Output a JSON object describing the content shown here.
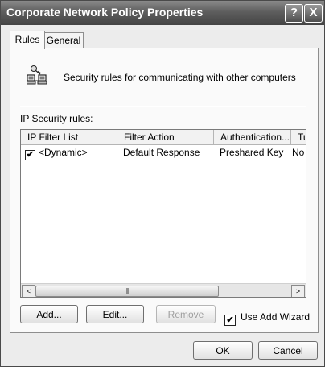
{
  "window": {
    "title": "Corporate Network Policy Properties",
    "help_button": "?",
    "close_button": "X"
  },
  "tabs": [
    {
      "label": "Rules",
      "active": true
    },
    {
      "label": "General",
      "active": false
    }
  ],
  "header": {
    "icon": "network-computers-icon",
    "text": "Security rules for communicating with other computers"
  },
  "list_label": "IP Security rules:",
  "table": {
    "columns": [
      "IP Filter List",
      "Filter Action",
      "Authentication...",
      "Tu"
    ],
    "rows": [
      {
        "checked": true,
        "ip_filter_list": "<Dynamic>",
        "filter_action": "Default Response",
        "authentication": "Preshared Key",
        "tunnel": "No"
      }
    ]
  },
  "scrollbar": {
    "left_arrow": "<",
    "right_arrow": ">",
    "thumb_grip": "|||"
  },
  "buttons": {
    "add": "Add...",
    "edit": "Edit...",
    "remove": "Remove",
    "ok": "OK",
    "cancel": "Cancel"
  },
  "use_add_wizard": {
    "label": "Use Add Wizard",
    "checked": true
  },
  "checkmark": "✔"
}
